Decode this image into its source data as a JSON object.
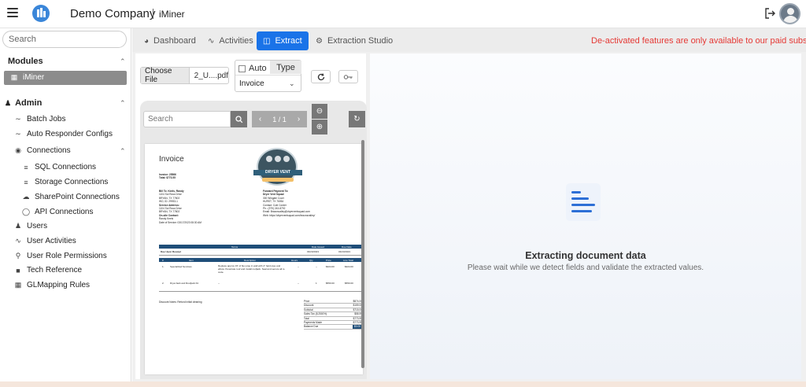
{
  "header": {
    "company": "Demo Company",
    "app_name": "iMiner"
  },
  "sidebar": {
    "search_placeholder": "Search",
    "modules_label": "Modules",
    "active_module": "iMiner",
    "admin_label": "Admin",
    "items": [
      {
        "label": "Batch Jobs",
        "icon": "batch-jobs-icon"
      },
      {
        "label": "Auto Responder Configs",
        "icon": "auto-responder-icon"
      },
      {
        "label": "Connections",
        "icon": "connections-icon"
      },
      {
        "label": "SQL Connections",
        "icon": "list-icon"
      },
      {
        "label": "Storage Connections",
        "icon": "list-icon"
      },
      {
        "label": "SharePoint Connections",
        "icon": "cloud-icon"
      },
      {
        "label": "API Connections",
        "icon": "globe-icon"
      },
      {
        "label": "Users",
        "icon": "users-icon"
      },
      {
        "label": "User Activities",
        "icon": "activity-icon"
      },
      {
        "label": "User Role Permissions",
        "icon": "lock-icon"
      },
      {
        "label": "Tech Reference",
        "icon": "book-icon"
      },
      {
        "label": "GLMapping Rules",
        "icon": "calculator-icon"
      }
    ]
  },
  "tabs": [
    {
      "label": "Dashboard",
      "icon": "dashboard-icon"
    },
    {
      "label": "Activities",
      "icon": "activity-icon"
    },
    {
      "label": "Extract",
      "icon": "file-icon",
      "active": true
    },
    {
      "label": "Extraction Studio",
      "icon": "studio-icon"
    }
  ],
  "notice": "De-activated features are only available to our paid subscribers.",
  "extract_panel": {
    "choose_file_label": "Choose File",
    "file_name": "2_U....pdf",
    "auto_label": "Auto",
    "type_label": "Type",
    "type_value": "Invoice"
  },
  "viewer": {
    "search_placeholder": "Search",
    "page_indicator": "1 / 1"
  },
  "invoice": {
    "title": "Invoice",
    "number": "Invoice: 25566",
    "total": "Total: $773.55",
    "logo_text": "DRYER VENT",
    "left_block": [
      "Bill To: Keels, Randy",
      "1104 Sul Ross Drive",
      "BRYAN, TX 77802",
      "WO, ID: 29933-1",
      "Service Address:",
      "1104 Sul Ross Drive",
      "BRYAN, TX 77802",
      "On-site Contact:",
      "Randy Keels",
      "Date of Service: 03/17/2023 08:30 AM"
    ],
    "right_block": [
      "Forward Payment To:",
      "Dryer Vent Squad",
      "300 Wingate Court",
      "HURST, TX 76054",
      "Contact: Cole Corder",
      "Ph.: (979) 243-8792",
      "Email: Brazosvalley@dryerventsquad.com",
      "Web: https://dryerventsquad.com/brazosvalley/"
    ],
    "terms_headers": [
      "Terms",
      "Date Issued",
      "Due Date"
    ],
    "terms_values": [
      "Due Upon Receipt",
      "03/23/2023",
      "03/23/2023"
    ],
    "line_headers": [
      "#",
      "Item",
      "Description",
      "Hours",
      "Qty",
      "Price",
      "Line Total"
    ],
    "lines": [
      [
        "1.",
        "Specialized Services",
        "Replace approx 15' of flex pipe in wall with 4\" hard pipe and elbow. Penetrate roof and install roofjack. Seal and secure all to code.",
        "--",
        "--",
        "$324.00",
        "$324.00"
      ],
      [
        "2.",
        "DryerJack and Roofjack Kit",
        "--",
        "--",
        "1",
        "$550.00",
        "$550.00"
      ]
    ],
    "notes": "Discount Notes: Refund initial cleaning",
    "summary": [
      [
        "Price",
        "$874.00"
      ],
      [
        "Discount",
        "$159.00"
      ],
      [
        "Subtotal",
        "$715.00"
      ],
      [
        "Sales Tax (8.2500%)",
        "$58.99"
      ],
      [
        "Total",
        "$773.99"
      ],
      [
        "Payments Made",
        "$773.99"
      ],
      [
        "Balance Due",
        "$0.00"
      ]
    ]
  },
  "extraction": {
    "title": "Extracting document data",
    "subtitle": "Please wait while we detect fields and validate the extracted values."
  },
  "colors": {
    "accent": "#1a73e8",
    "notice": "#e53935",
    "invoice_header": "#1f4e79"
  }
}
